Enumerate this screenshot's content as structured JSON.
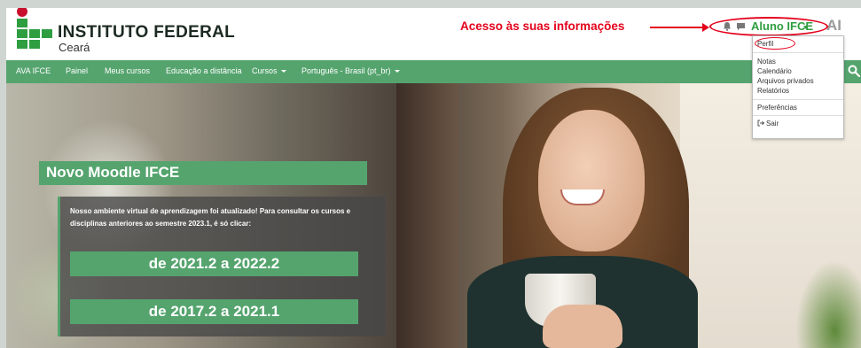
{
  "header": {
    "brand_title": "INSTITUTO FEDERAL",
    "brand_subtitle": "Ceará",
    "annotation": "Acesso às suas informações",
    "user_name": "Aluno IFCE",
    "avatar_initials": "AI"
  },
  "nav": {
    "items": [
      {
        "label": "AVA IFCE",
        "caret": false
      },
      {
        "label": "Painel",
        "caret": false
      },
      {
        "label": "Meus cursos",
        "caret": false
      },
      {
        "label": "Educação a distância",
        "caret": false
      },
      {
        "label": "Cursos",
        "caret": true
      },
      {
        "label": "Português - Brasil (pt_br)",
        "caret": true
      }
    ]
  },
  "user_menu": {
    "items": [
      "Perfil",
      "Notas",
      "Calendário",
      "Arquivos privados",
      "Relatórios",
      "Preferências",
      "Sair"
    ]
  },
  "hero": {
    "title": "Novo Moodle IFCE",
    "text": "Nosso ambiente virtual de aprendizagem foi atualizado! Para consultar os cursos e disciplinas anteriores ao semestre 2023.1, é só clicar:",
    "button_1": "de 2021.2 a 2022.2",
    "button_2": "de 2017.2 a 2021.1"
  },
  "colors": {
    "brand_green": "#55a46e",
    "logo_green": "#2f9e41",
    "logo_red": "#c8102e",
    "annotation_red": "#e3001b"
  },
  "icons": [
    "bell-icon",
    "chat-icon",
    "search-icon",
    "logout-icon"
  ]
}
